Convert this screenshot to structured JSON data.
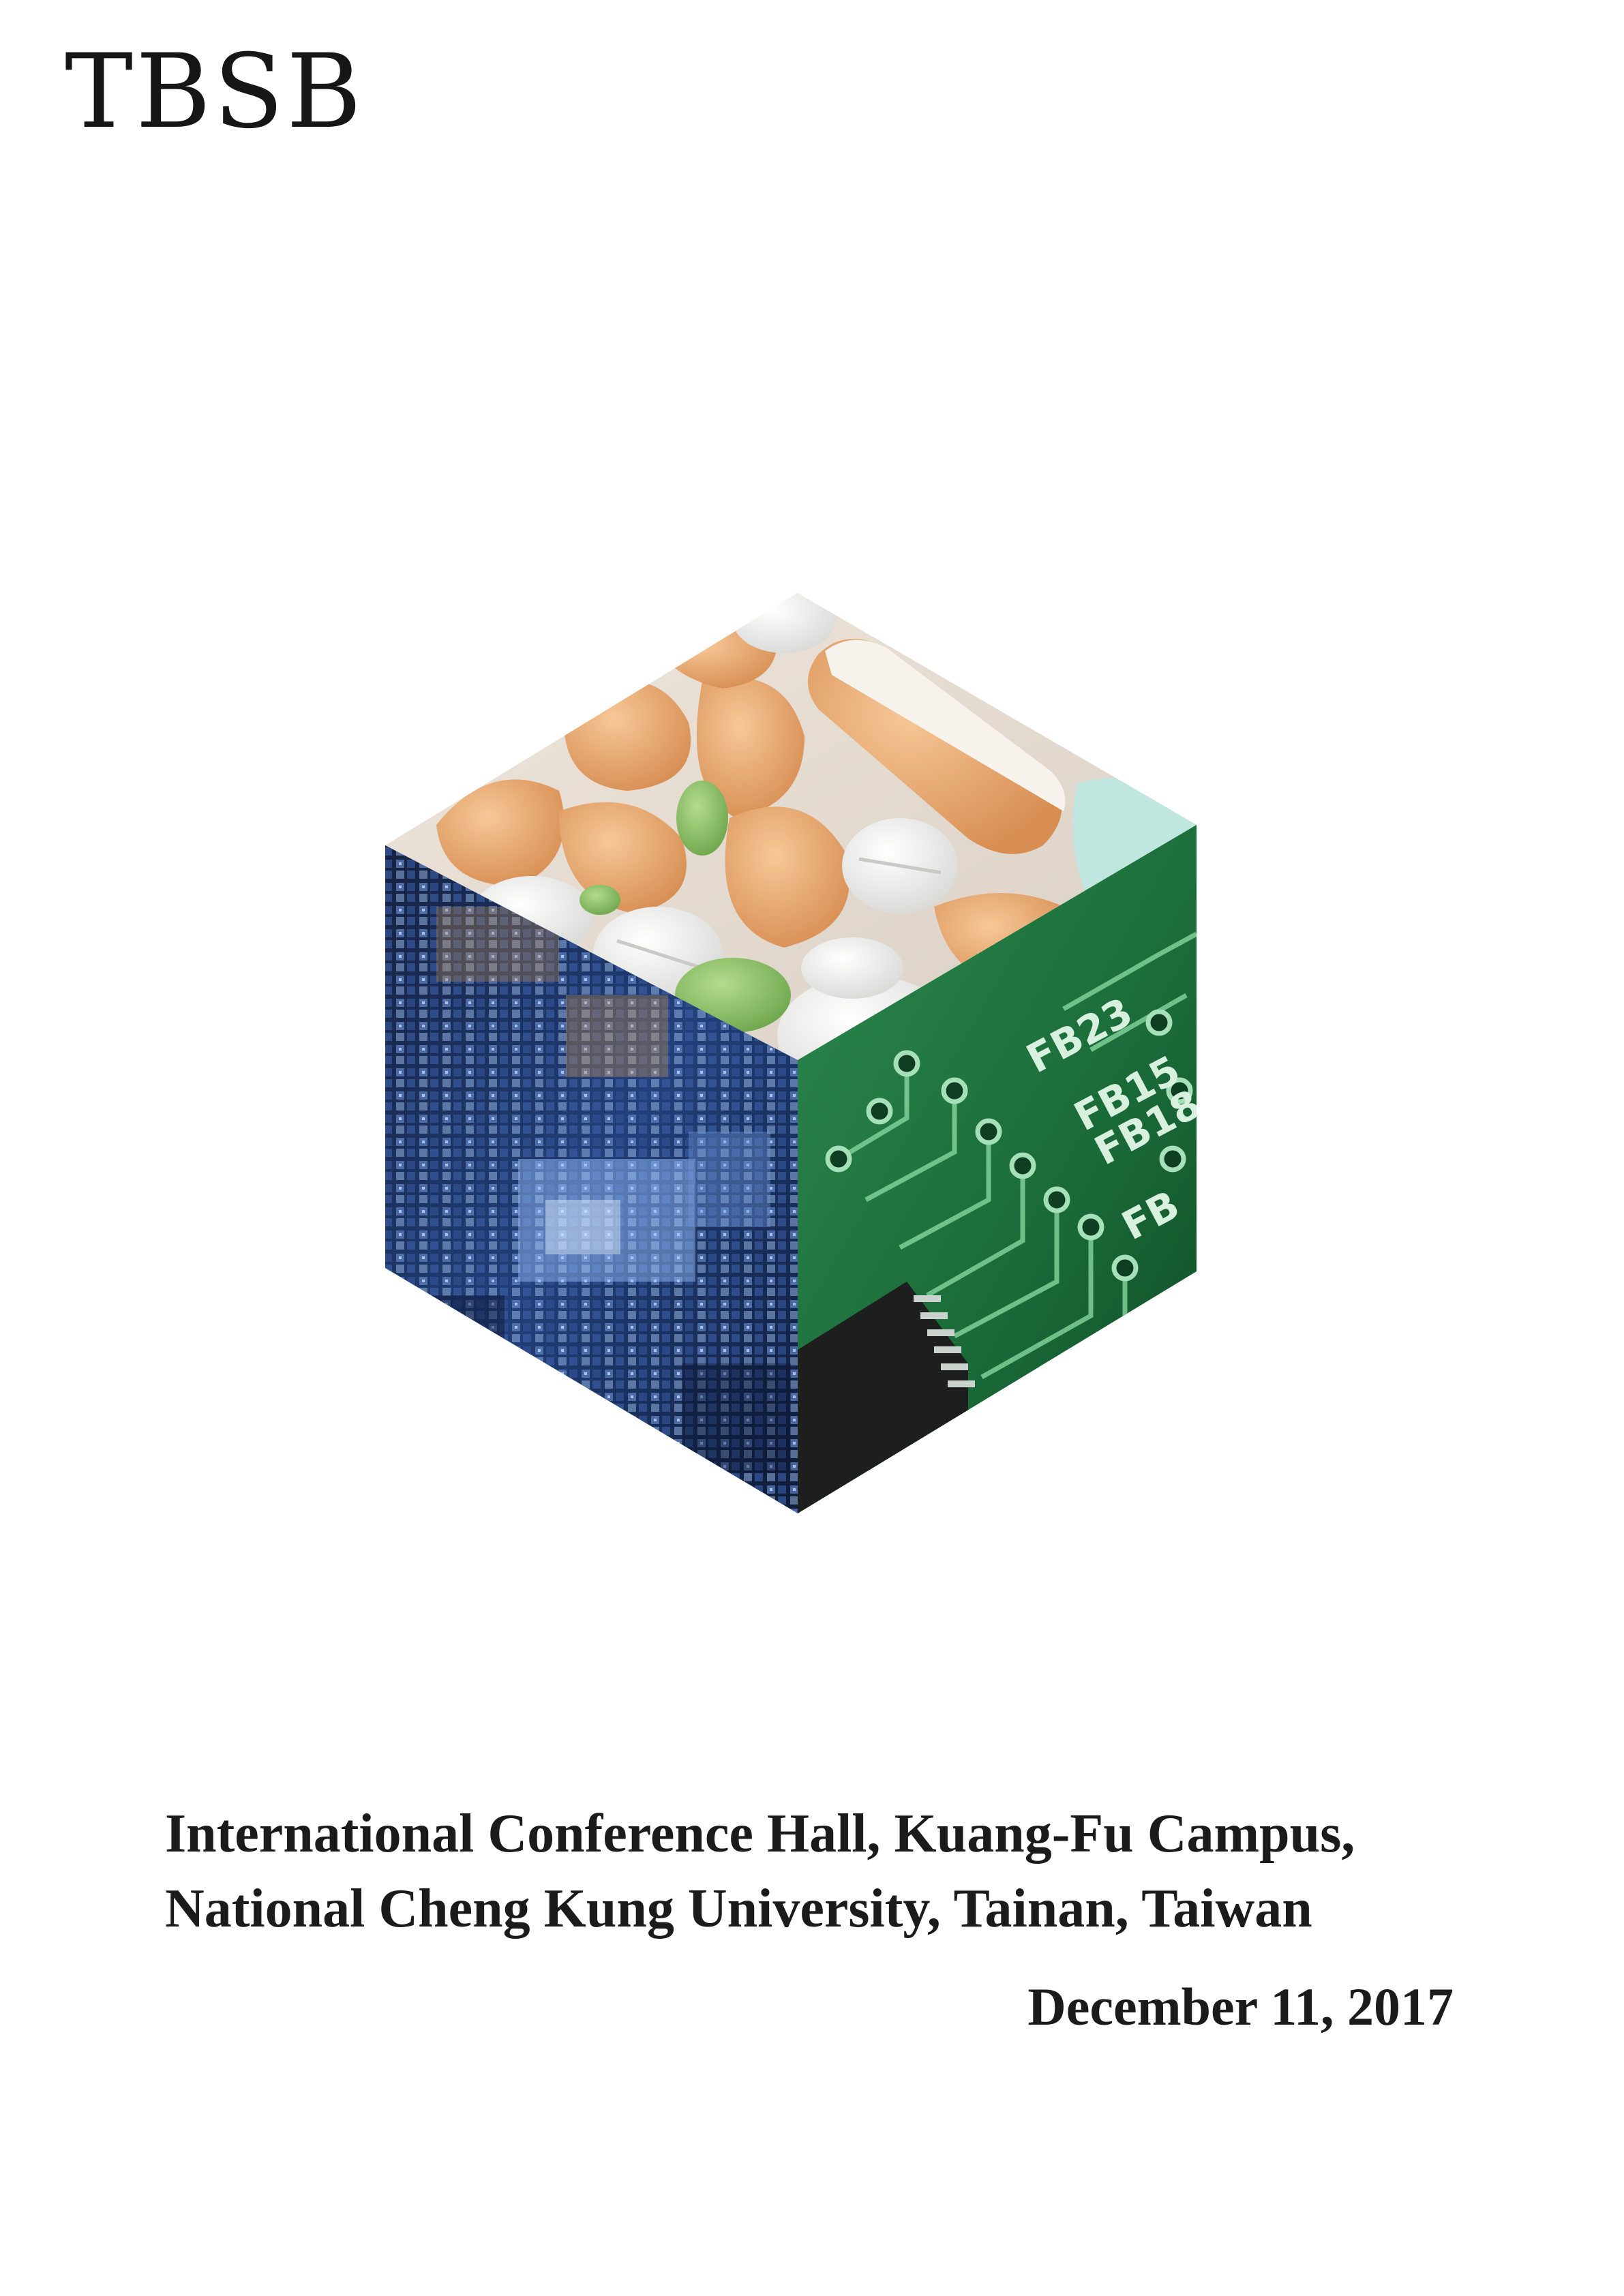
{
  "header": {
    "logo_text": "TBSB"
  },
  "cover_image": {
    "icon": "hexagonal-cube-collage",
    "faces": [
      "pills",
      "fractal-grid",
      "circuit-board"
    ],
    "circuit_labels": [
      "FB23",
      "FB15",
      "FB18",
      "FB"
    ],
    "colors": {
      "pill_orange": "#e9a873",
      "pill_white": "#f4f4f2",
      "pill_green": "#8cc26a",
      "fractal_blue": "#2b4a8a",
      "circuit_green": "#1f6b3a"
    }
  },
  "footer": {
    "venue_line_1": "International Conference Hall, Kuang-Fu Campus,",
    "venue_line_2": "National Cheng Kung University, Tainan, Taiwan",
    "date": "December 11, 2017"
  }
}
